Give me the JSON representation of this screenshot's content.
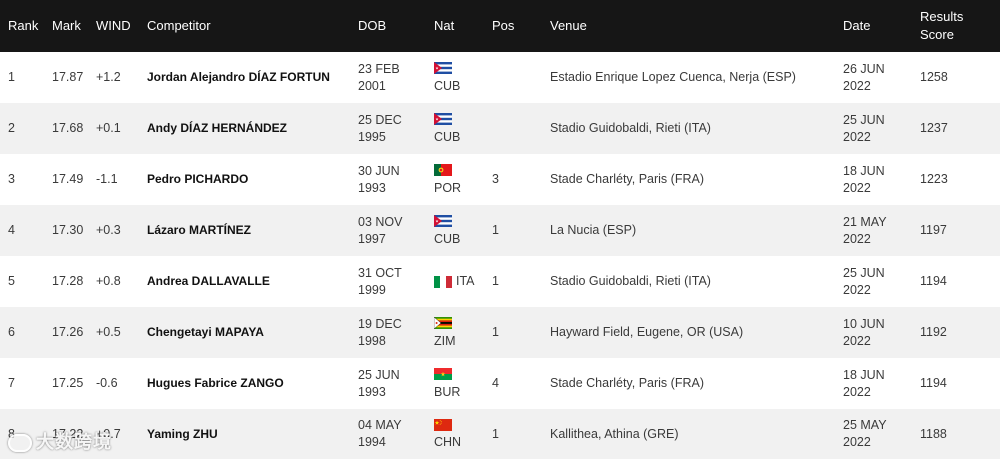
{
  "headers": {
    "rank": "Rank",
    "mark": "Mark",
    "wind": "WIND",
    "competitor": "Competitor",
    "dob": "DOB",
    "nat": "Nat",
    "pos": "Pos",
    "venue": "Venue",
    "date": "Date",
    "score_line1": "Results",
    "score_line2": "Score"
  },
  "rows": [
    {
      "rank": "1",
      "mark": "17.87",
      "wind": "+1.2",
      "competitor": "Jordan Alejandro DÍAZ FORTUN",
      "dob1": "23 FEB",
      "dob2": "2001",
      "nat": "CUB",
      "flag": "cuba-flag-icon",
      "pos": "",
      "venue": "Estadio Enrique Lopez Cuenca, Nerja (ESP)",
      "date1": "26 JUN",
      "date2": "2022",
      "score": "1258"
    },
    {
      "rank": "2",
      "mark": "17.68",
      "wind": "+0.1",
      "competitor": "Andy DÍAZ HERNÁNDEZ",
      "dob1": "25 DEC",
      "dob2": "1995",
      "nat": "CUB",
      "flag": "cuba-flag-icon",
      "pos": "",
      "venue": "Stadio Guidobaldi, Rieti (ITA)",
      "date1": "25 JUN",
      "date2": "2022",
      "score": "1237"
    },
    {
      "rank": "3",
      "mark": "17.49",
      "wind": "-1.1",
      "competitor": "Pedro PICHARDO",
      "dob1": "30 JUN",
      "dob2": "1993",
      "nat": "POR",
      "flag": "portugal-flag-icon",
      "pos": "3",
      "venue": "Stade Charléty, Paris (FRA)",
      "date1": "18 JUN",
      "date2": "2022",
      "score": "1223"
    },
    {
      "rank": "4",
      "mark": "17.30",
      "wind": "+0.3",
      "competitor": "Lázaro MARTÍNEZ",
      "dob1": "03 NOV",
      "dob2": "1997",
      "nat": "CUB",
      "flag": "cuba-flag-icon",
      "pos": "1",
      "venue": "La Nucia (ESP)",
      "date1": "21 MAY",
      "date2": "2022",
      "score": "1197"
    },
    {
      "rank": "5",
      "mark": "17.28",
      "wind": "+0.8",
      "competitor": "Andrea DALLAVALLE",
      "dob1": "31 OCT",
      "dob2": "1999",
      "nat": "ITA",
      "flag": "italy-flag-icon",
      "pos": "1",
      "venue": "Stadio Guidobaldi, Rieti (ITA)",
      "date1": "25 JUN",
      "date2": "2022",
      "score": "1194"
    },
    {
      "rank": "6",
      "mark": "17.26",
      "wind": "+0.5",
      "competitor": "Chengetayi MAPAYA",
      "dob1": "19 DEC",
      "dob2": "1998",
      "nat": "ZIM",
      "flag": "zimbabwe-flag-icon",
      "pos": "1",
      "venue": "Hayward Field, Eugene, OR (USA)",
      "date1": "10 JUN",
      "date2": "2022",
      "score": "1192"
    },
    {
      "rank": "7",
      "mark": "17.25",
      "wind": "-0.6",
      "competitor": "Hugues Fabrice ZANGO",
      "dob1": "25 JUN",
      "dob2": "1993",
      "nat": "BUR",
      "flag": "burkina-faso-flag-icon",
      "pos": "4",
      "venue": "Stade Charléty, Paris (FRA)",
      "date1": "18 JUN",
      "date2": "2022",
      "score": "1194"
    },
    {
      "rank": "8",
      "mark": "17.22",
      "wind": "+0.7",
      "competitor": "Yaming ZHU",
      "dob1": "04 MAY",
      "dob2": "1994",
      "nat": "CHN",
      "flag": "china-flag-icon",
      "pos": "1",
      "venue": "Kallithea, Athina (GRE)",
      "date1": "25 MAY",
      "date2": "2022",
      "score": "1188"
    }
  ],
  "watermark": "大数跨境"
}
